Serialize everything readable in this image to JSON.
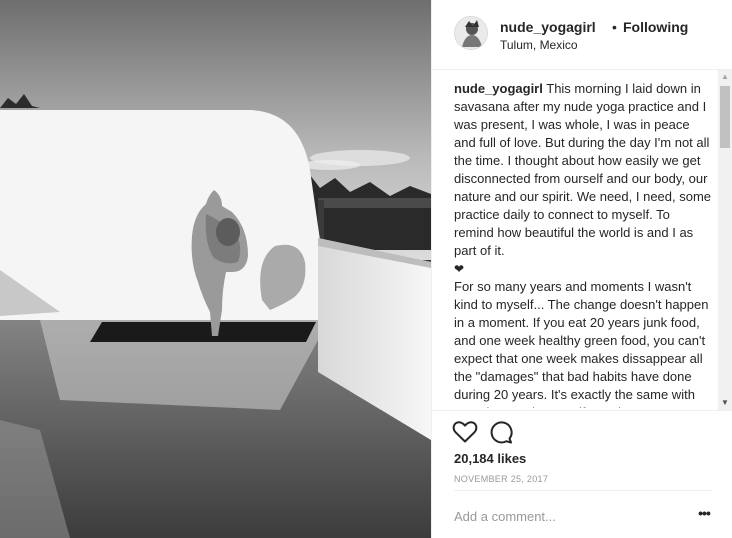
{
  "post": {
    "username": "nude_yogagirl",
    "separator": "•",
    "follow_status": "Following",
    "location": "Tulum, Mexico"
  },
  "caption": {
    "username": "nude_yogagirl",
    "paragraph1": "This morning I laid down in savasana after my nude yoga practice and I was present, I was whole, I was in peace and full of love. But during the day I'm not all the time. I thought about how easily we get disconnected from ourself and our body, our nature and our spirit. We need, I need, some practice daily to connect to myself. To remind how beautiful the world is and I as part of it.",
    "heart": "❤",
    "paragraph2": "For so many years and moments I wasn't kind to myself... The change doesn't happen in a moment. If you eat 20 years junk food, and one week healthy green food, you can't expect that one week makes dissappear all the \"damages\" that bad habits have done during 20 years. It's exactly the same with negative words... But if you don't start now, when?",
    "heart2": "❤"
  },
  "stats": {
    "likes": "20,184 likes",
    "date": "NOVEMBER 25, 2017"
  },
  "comment": {
    "placeholder": "Add a comment...",
    "more": "•••"
  },
  "icons": {
    "like": "heart-outline-icon",
    "comment": "speech-bubble-icon",
    "scroll_up": "triangle-up-icon",
    "scroll_down": "triangle-down-icon"
  }
}
